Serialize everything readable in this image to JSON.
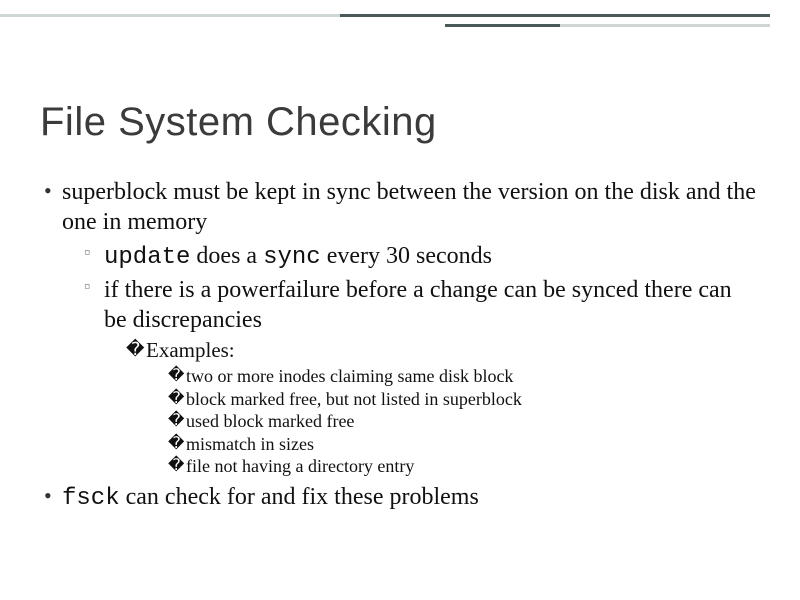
{
  "title": "File System Checking",
  "bullets": {
    "b1_pre": "superblock must be kept in sync between the version on the disk and the one in memory",
    "b1_s1_a": "update",
    "b1_s1_b": " does a ",
    "b1_s1_c": "sync",
    "b1_s1_d": " every 30 seconds",
    "b1_s2": "if there is a powerfailure before a change can be synced there can be discrepancies",
    "b1_s2_ex_label": "Examples:",
    "b1_s2_ex1": "two or more inodes claiming same disk block",
    "b1_s2_ex2": "block marked free, but not listed in superblock",
    "b1_s2_ex3": "used block marked free",
    "b1_s2_ex4": "mismatch in sizes",
    "b1_s2_ex5": "file not having a directory entry",
    "b2_a": "fsck",
    "b2_b": " can check for and fix these problems"
  }
}
